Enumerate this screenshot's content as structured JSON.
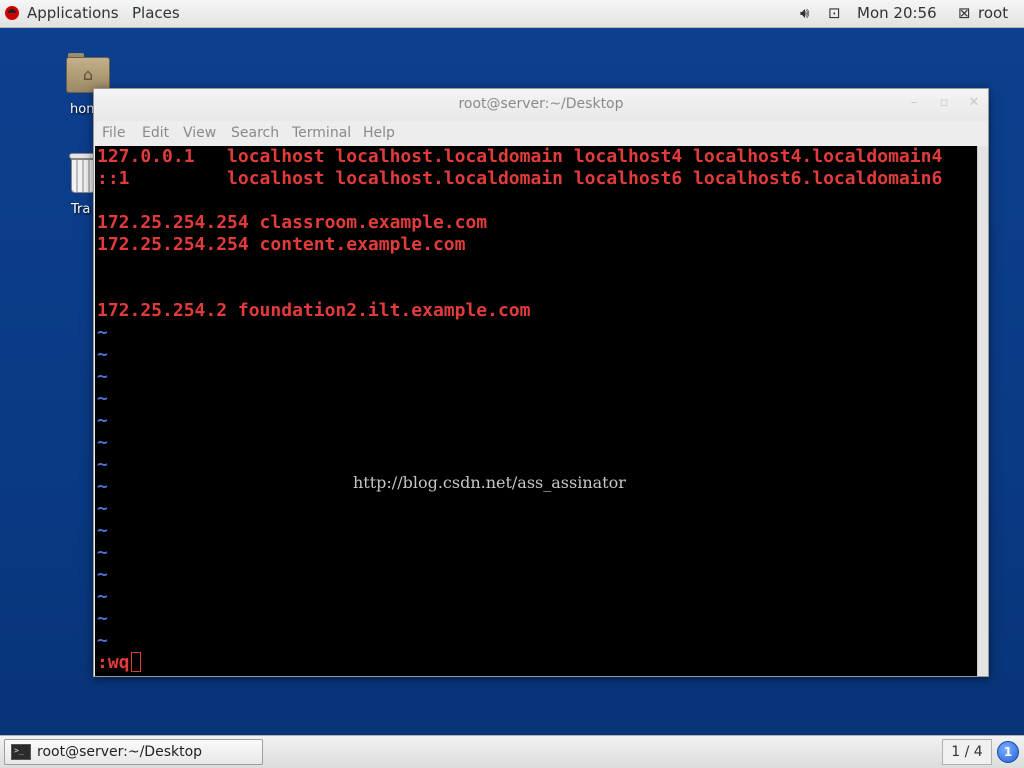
{
  "top_panel": {
    "applications_label": "Applications",
    "places_label": "Places",
    "clock": "Mon 20:56",
    "user": "root",
    "icons": [
      "redhat-logo-icon",
      "volume-icon",
      "network-icon",
      "user-icon"
    ]
  },
  "desktop": {
    "icons": [
      {
        "label": "hon",
        "icon": "home-folder-icon"
      },
      {
        "label": "Tra",
        "icon": "trash-icon"
      }
    ]
  },
  "window": {
    "title": "root@server:~/Desktop",
    "menu": [
      "File",
      "Edit",
      "View",
      "Search",
      "Terminal",
      "Help"
    ],
    "terminal": {
      "lines": [
        "127.0.0.1   localhost localhost.localdomain localhost4 localhost4.localdomain4",
        "::1         localhost localhost.localdomain localhost6 localhost6.localdomain6",
        "",
        "172.25.254.254 classroom.example.com",
        "172.25.254.254 content.example.com",
        "",
        "",
        "172.25.254.2 foundation2.ilt.example.com"
      ],
      "tilde": "~",
      "command": ":wq",
      "watermark": "http://blog.csdn.net/ass_assinator"
    }
  },
  "bottom_panel": {
    "task_label": "root@server:~/Desktop",
    "workspace": "1 / 4",
    "notification_count": "1"
  },
  "colors": {
    "terminal_text": "#e23b3b",
    "tilde": "#4d6fd6",
    "desktop_bg": "#0b3d8c"
  }
}
